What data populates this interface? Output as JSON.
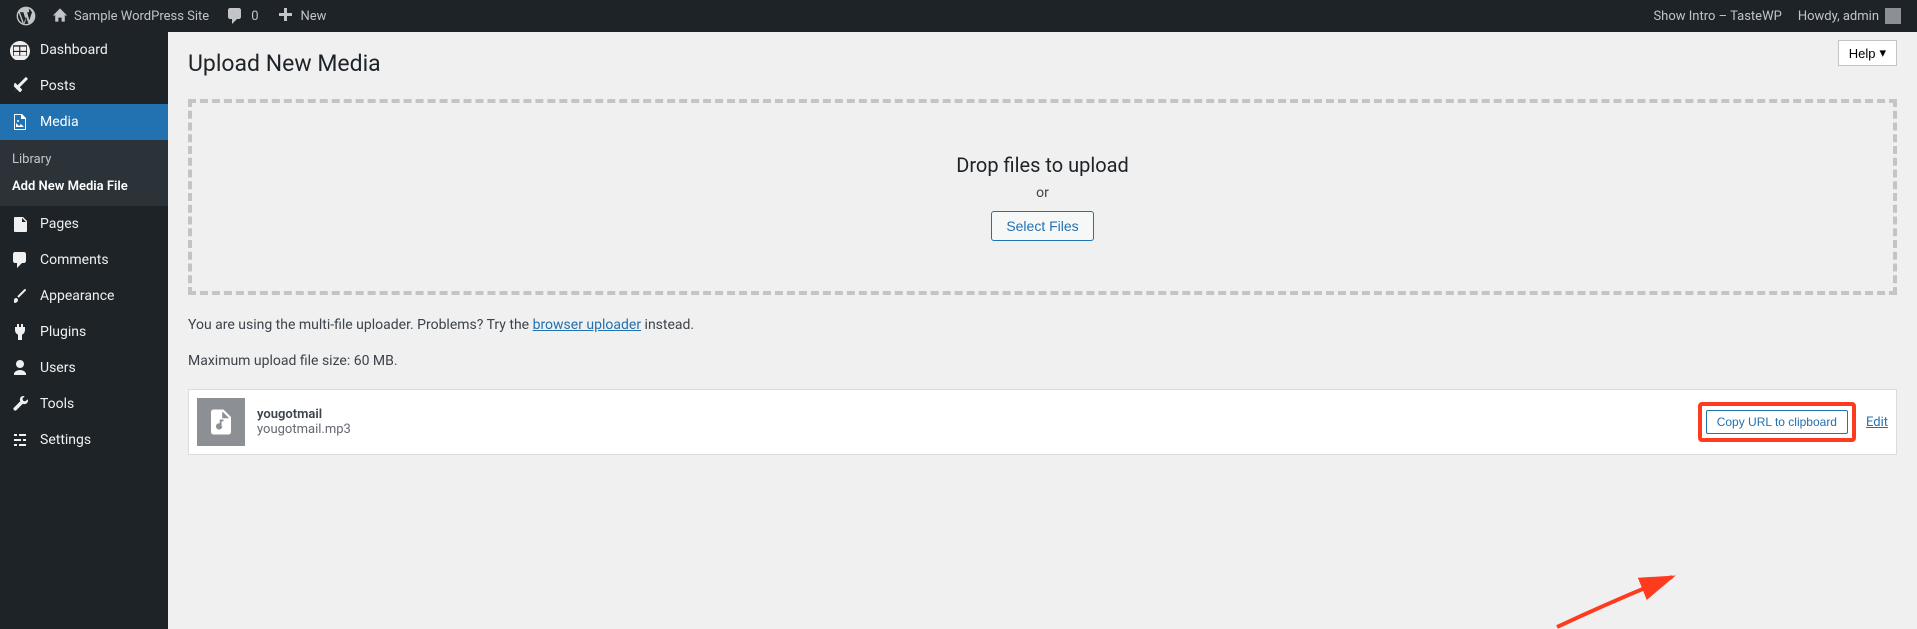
{
  "adminbar": {
    "site_title": "Sample WordPress Site",
    "comments_count": "0",
    "new_label": "New",
    "show_intro": "Show Intro – TasteWP",
    "howdy": "Howdy, admin"
  },
  "sidebar": {
    "items": [
      {
        "label": "Dashboard"
      },
      {
        "label": "Posts"
      },
      {
        "label": "Media"
      },
      {
        "label": "Pages"
      },
      {
        "label": "Comments"
      },
      {
        "label": "Appearance"
      },
      {
        "label": "Plugins"
      },
      {
        "label": "Users"
      },
      {
        "label": "Tools"
      },
      {
        "label": "Settings"
      }
    ],
    "submenu": {
      "library": "Library",
      "add_new": "Add New Media File"
    }
  },
  "content": {
    "help": "Help",
    "title": "Upload New Media",
    "uploader": {
      "drop": "Drop files to upload",
      "or": "or",
      "select": "Select Files"
    },
    "note_prefix": "You are using the multi-file uploader. Problems? Try the ",
    "note_link": "browser uploader",
    "note_suffix": " instead.",
    "max_size": "Maximum upload file size: 60 MB.",
    "media_item": {
      "title": "yougotmail",
      "filename": "yougotmail.mp3",
      "copy_url": "Copy URL to clipboard",
      "edit": "Edit"
    }
  }
}
